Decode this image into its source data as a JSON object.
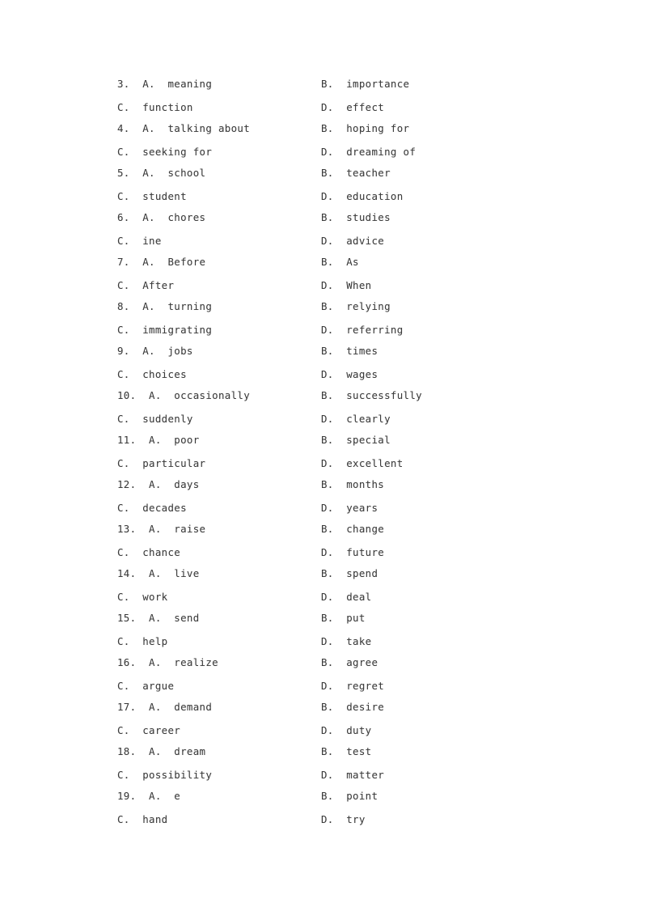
{
  "document": {
    "type": "cloze-test-options",
    "page_background": "#ffffff",
    "text_color": "#3c3c3c",
    "first_question_number": 3,
    "last_question_number": 19
  },
  "questions": [
    {
      "number": "3.",
      "a": "3.  A.  meaning",
      "b": "B.  importance",
      "c": "C.  function",
      "d": "D.  effect"
    },
    {
      "number": "4.",
      "a": "4.  A.  talking about",
      "b": "B.  hoping for",
      "c": "C.  seeking for",
      "d": "D.  dreaming of"
    },
    {
      "number": "5.",
      "a": "5.  A.  school",
      "b": "B.  teacher",
      "c": "C.  student",
      "d": "D.  education"
    },
    {
      "number": "6.",
      "a": "6.  A.  chores",
      "b": "B.  studies",
      "c": "C.  ine",
      "d": "D.  advice"
    },
    {
      "number": "7.",
      "a": "7.  A.  Before",
      "b": "B.  As",
      "c": "C.  After",
      "d": "D.  When"
    },
    {
      "number": "8.",
      "a": "8.  A.  turning",
      "b": "B.  relying",
      "c": "C.  immigrating",
      "d": "D.  referring"
    },
    {
      "number": "9.",
      "a": "9.  A.  jobs",
      "b": "B.  times",
      "c": "C.  choices",
      "d": "D.  wages"
    },
    {
      "number": "10.",
      "a": "10.  A.  occasionally",
      "b": "B.  successfully",
      "c": "C.  suddenly",
      "d": "D.  clearly"
    },
    {
      "number": "11.",
      "a": "11.  A.  poor",
      "b": "B.  special",
      "c": "C.  particular",
      "d": "D.  excellent"
    },
    {
      "number": "12.",
      "a": "12.  A.  days",
      "b": "B.  months",
      "c": "C.  decades",
      "d": "D.  years"
    },
    {
      "number": "13.",
      "a": "13.  A.  raise",
      "b": "B.  change",
      "c": "C.  chance",
      "d": "D.  future"
    },
    {
      "number": "14.",
      "a": "14.  A.  live",
      "b": "B.  spend",
      "c": "C.  work",
      "d": "D.  deal"
    },
    {
      "number": "15.",
      "a": "15.  A.  send",
      "b": "B.  put",
      "c": "C.  help",
      "d": "D.  take"
    },
    {
      "number": "16.",
      "a": "16.  A.  realize",
      "b": "B.  agree",
      "c": "C.  argue",
      "d": "D.  regret"
    },
    {
      "number": "17.",
      "a": "17.  A.  demand",
      "b": "B.  desire",
      "c": "C.  career",
      "d": "D.  duty"
    },
    {
      "number": "18.",
      "a": "18.  A.  dream",
      "b": "B.  test",
      "c": "C.  possibility",
      "d": "D.  matter"
    },
    {
      "number": "19.",
      "a": "19.  A.  e",
      "b": "B.  point",
      "c": "C.  hand",
      "d": "D.  try"
    }
  ]
}
